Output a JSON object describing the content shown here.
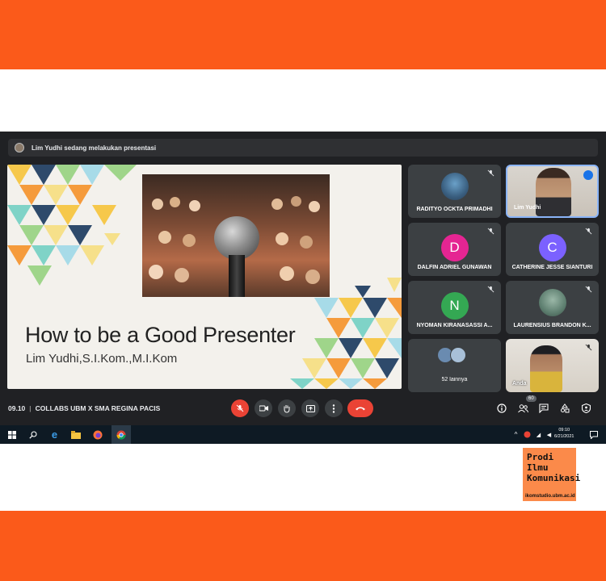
{
  "colors": {
    "brand_orange": "#fb5a1a",
    "meet_dark": "#202124",
    "tile_gray": "#3c4043",
    "end_call_red": "#ea4335",
    "active_blue": "#8ab4f8"
  },
  "meeting": {
    "presenting_banner": "Lim Yudhi sedang melakukan presentasi",
    "time": "09.10",
    "title": "COLLABS UBM X SMA REGINA PACIS",
    "separator": "|"
  },
  "slide": {
    "title": "How to be a Good Presenter",
    "subtitle": "Lim Yudhi,S.I.Kom.,M.I.Kom",
    "image": "microphone-audience-photo"
  },
  "participants": [
    {
      "name": "RADITYO OCKTA PRIMADHI",
      "avatar": "photo",
      "muted": true
    },
    {
      "name": "Lim Yudhi",
      "avatar": "video",
      "speaking": true
    },
    {
      "name": "DALFIN ADRIEL GUNAWAN",
      "avatar": "D",
      "color": "#e52592",
      "muted": true
    },
    {
      "name": "CATHERINE JESSE SIANTURI",
      "avatar": "C",
      "color": "#7b61ff",
      "muted": true
    },
    {
      "name": "NYOMAN KIRANASASSI A...",
      "avatar": "N",
      "color": "#34a853",
      "muted": true
    },
    {
      "name": "LAURENSIUS BRANDON K...",
      "avatar": "photo",
      "muted": true
    },
    {
      "name": "52 lainnya",
      "avatar": "group"
    },
    {
      "name": "Anda",
      "avatar": "video",
      "muted": true
    }
  ],
  "controls": {
    "participant_count": "60",
    "icons": [
      "mic-off-icon",
      "camera-icon",
      "raise-hand-icon",
      "present-icon",
      "more-icon",
      "end-call-icon",
      "info-icon",
      "people-icon",
      "chat-icon",
      "activities-icon",
      "shield-icon"
    ]
  },
  "taskbar": {
    "time": "09:10",
    "date": "6/21/2021"
  },
  "branding": {
    "line1": "Prodi",
    "line2": "Ilmu",
    "line3": "Komunikasi",
    "url": "ikomstudio.ubm.ac.id"
  }
}
